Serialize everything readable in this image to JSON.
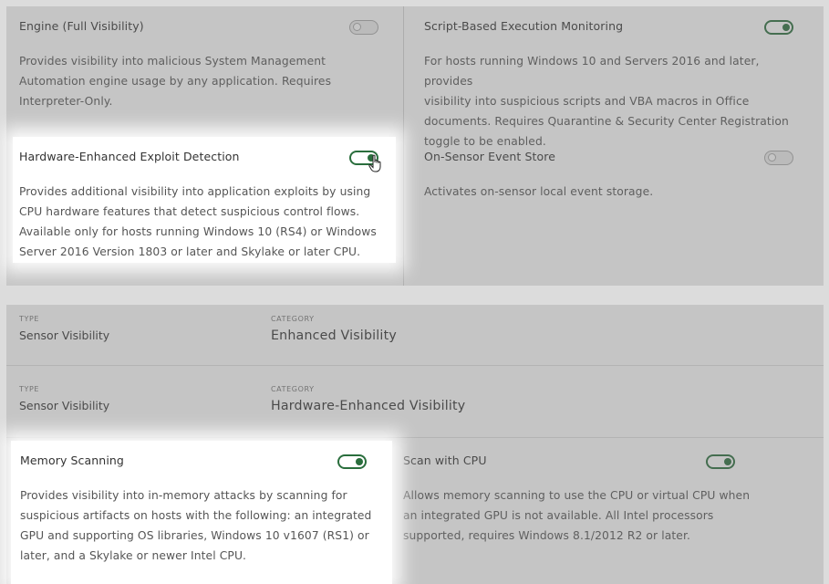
{
  "panel1": {
    "settings": [
      {
        "title": "Engine (Full Visibility)",
        "enabled": false,
        "description": [
          "Provides visibility into malicious System Management",
          "Automation engine usage by any application. Requires",
          "Interpreter-Only."
        ]
      },
      {
        "title": "Script-Based Execution Monitoring",
        "enabled": true,
        "description": [
          "For hosts running Windows 10 and Servers 2016 and later, provides",
          "visibility into suspicious scripts and VBA macros in Office",
          "documents. Requires Quarantine & Security Center Registration",
          "toggle to be enabled."
        ]
      },
      {
        "title": "Hardware-Enhanced Exploit Detection",
        "enabled": true,
        "description": [
          "Provides additional visibility into application exploits by using",
          "CPU hardware features that detect suspicious control flows.",
          "Available only for hosts running Windows 10 (RS4) or Windows",
          "Server 2016 Version 1803 or later and Skylake or later CPU."
        ]
      },
      {
        "title": "On-Sensor Event Store",
        "enabled": false,
        "description": [
          "Activates on-sensor local event storage."
        ]
      }
    ]
  },
  "panel2": {
    "groups": [
      {
        "type_label": "TYPE",
        "type_value": "Sensor Visibility",
        "category_label": "CATEGORY",
        "category_value": "Enhanced Visibility"
      },
      {
        "type_label": "TYPE",
        "type_value": "Sensor Visibility",
        "category_label": "CATEGORY",
        "category_value": "Hardware-Enhanced Visibility"
      }
    ],
    "settings": [
      {
        "title": "Memory Scanning",
        "enabled": true,
        "description": [
          "Provides visibility into in-memory attacks by scanning for",
          "suspicious artifacts on hosts with the following: an integrated",
          "GPU and supporting OS libraries, Windows 10 v1607 (RS1) or",
          "later, and a Skylake or newer Intel CPU."
        ]
      },
      {
        "title": "Scan with CPU",
        "enabled": true,
        "description": [
          "Allows memory scanning to use the CPU or virtual CPU when",
          "an integrated GPU is not available. All Intel processors",
          "supported, requires Windows 8.1/2012 R2 or later."
        ]
      }
    ]
  },
  "colors": {
    "toggle_on": "#2a6e3d",
    "toggle_off": "#aaaaaa",
    "dim_overlay": "rgba(110,110,110,0.4)"
  },
  "icons": {
    "cursor": "hand-pointer-icon"
  }
}
